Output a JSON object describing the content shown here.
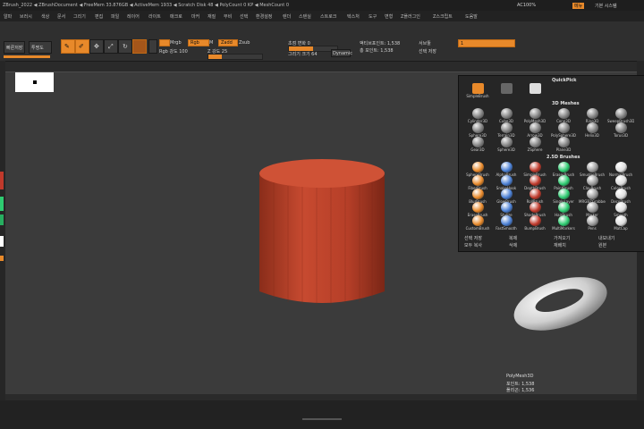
{
  "title_bar": {
    "text": "ZBrush_2022 ◀ ZBrushDocument ◀ FreeMem 33.876GB ◀ ActiveMem 1933 ◀ Scratch Disk 48 ◀ PolyCount 0 KP ◀ MeshCount 0"
  },
  "top_right": {
    "label1": "AC100%",
    "label2": "메뉴",
    "label3": "기본 시스템"
  },
  "menu_items": [
    "알파",
    "브러시",
    "색상",
    "문서",
    "그리기",
    "편집",
    "파일",
    "레이어",
    "라이트",
    "매크로",
    "마커",
    "재질",
    "무비",
    "선택",
    "환경설정",
    "렌더",
    "스텐실",
    "스트로크",
    "텍스처",
    "도구",
    "변형",
    "Z플러그인",
    "Z스크립트",
    "도움말"
  ],
  "toolbar": {
    "left_btns": [
      "빠른저장",
      "투명도",
      "라이트박스"
    ],
    "mode_btns": [
      "편집",
      "그리기",
      "이동",
      "크기",
      "회전"
    ],
    "mrgb": "Mrgb",
    "rgb": "Rgb",
    "rgb_intensity": "Rgb 강도 100",
    "m": "M",
    "zadd": "Zadd",
    "zsub": "Zsub",
    "z_intensity": "Z 강도 25",
    "focal": "초점 변화 0",
    "draw_size": "그리기 크기 64",
    "dynamic": "Dynamic",
    "active_points": "액티브포인트: 1,538",
    "total_points": "총 포인트: 1,538",
    "subtool_label": "서브툴",
    "subtool_value": "1"
  },
  "quickpick": {
    "header": "QuickPick",
    "row1": [
      "SimpleBrush",
      "",
      ""
    ],
    "section_3d": "3D Meshes",
    "meshes": [
      "Cylinder3D",
      "Cube3D",
      "PolyMesh3D",
      "Cone3D",
      "Ring3D",
      "SweepBrush3D",
      "Sphere3D",
      "Terrain3D",
      "Arrow3D",
      "PolySphere3D",
      "Helix3D",
      "Torus3D",
      "Gear3D",
      "Sphere3D",
      "ZSphere",
      "Plane3D"
    ],
    "section_2d": "2.5D Brushes",
    "brushes": [
      "SphereBrush",
      "AlphaBrush",
      "SimpleBrush",
      "EraserBrush",
      "SmudgeBrush",
      "NormalBrush",
      "FiberBrush",
      "SnakeHook",
      "DepthBrush",
      "PaintBrush",
      "ClayBrush",
      "ColorBrush",
      "BlurBrush",
      "GlowBrush",
      "RollBrush",
      "SingleLayer",
      "MRGBZGrabber",
      "DecoBrush",
      "EraseBrush",
      "Stylize",
      "ShadeBrush",
      "HairBrush",
      "Marker",
      "Smooth",
      "CustomBrush",
      "FastSmooth",
      "BumpBrush",
      "MultiMarkers",
      "Pens",
      "MatCap"
    ],
    "footer": [
      "선택 저장",
      "복제",
      "가져오기",
      "내보내기",
      "모두 복사",
      "삭제",
      "재배치",
      "원본"
    ]
  },
  "info": {
    "name": "PolyMesh3D",
    "points": "포인트: 1,538",
    "polys": "폴리곤: 1,536"
  },
  "left_swatches": [
    "#c0392b",
    "#2ecc71",
    "#27ae60",
    "#ffffff"
  ],
  "accent": "#e8892a",
  "cylinder_color": "#c0472e"
}
